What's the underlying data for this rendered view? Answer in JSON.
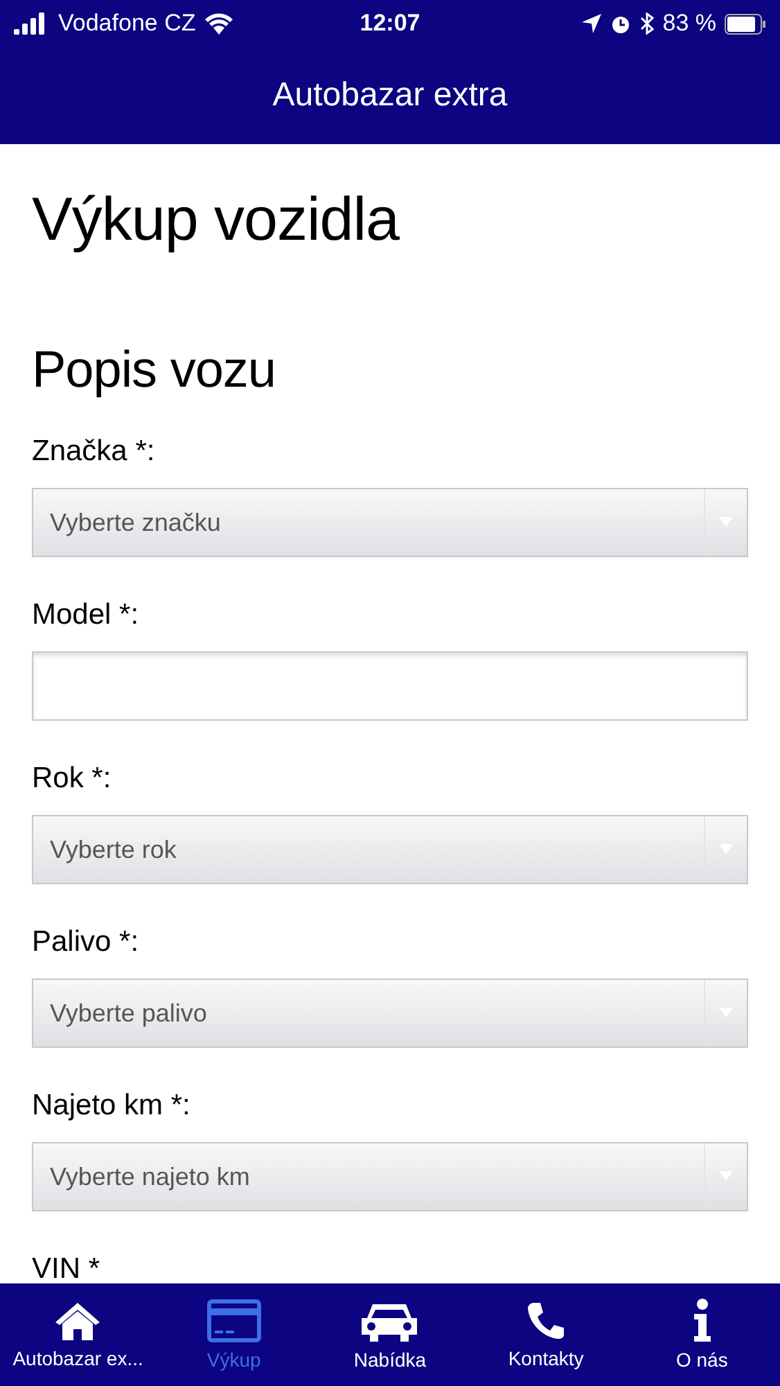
{
  "status_bar": {
    "carrier": "Vodafone CZ",
    "time": "12:07",
    "battery": "83 %"
  },
  "header": {
    "title": "Autobazar extra"
  },
  "page_title": "Výkup vozidla",
  "section_title": "Popis vozu",
  "fields": [
    {
      "label": "Značka *:",
      "kind": "select",
      "placeholder": "Vyberte značku"
    },
    {
      "label": "Model *:",
      "kind": "text"
    },
    {
      "label": "Rok *:",
      "kind": "select",
      "placeholder": "Vyberte rok"
    },
    {
      "label": "Palivo *:",
      "kind": "select",
      "placeholder": "Vyberte palivo"
    },
    {
      "label": "Najeto km *:",
      "kind": "select",
      "placeholder": "Vyberte najeto km"
    },
    {
      "label": "VIN *",
      "kind": "label"
    }
  ],
  "tabs": [
    {
      "label": "Autobazar ex...",
      "kind": "home",
      "selected": false
    },
    {
      "label": "Výkup",
      "kind": "card",
      "selected": true
    },
    {
      "label": "Nabídka",
      "kind": "car",
      "selected": false
    },
    {
      "label": "Kontakty",
      "kind": "phone",
      "selected": false
    },
    {
      "label": "O nás",
      "kind": "info",
      "selected": false
    }
  ]
}
